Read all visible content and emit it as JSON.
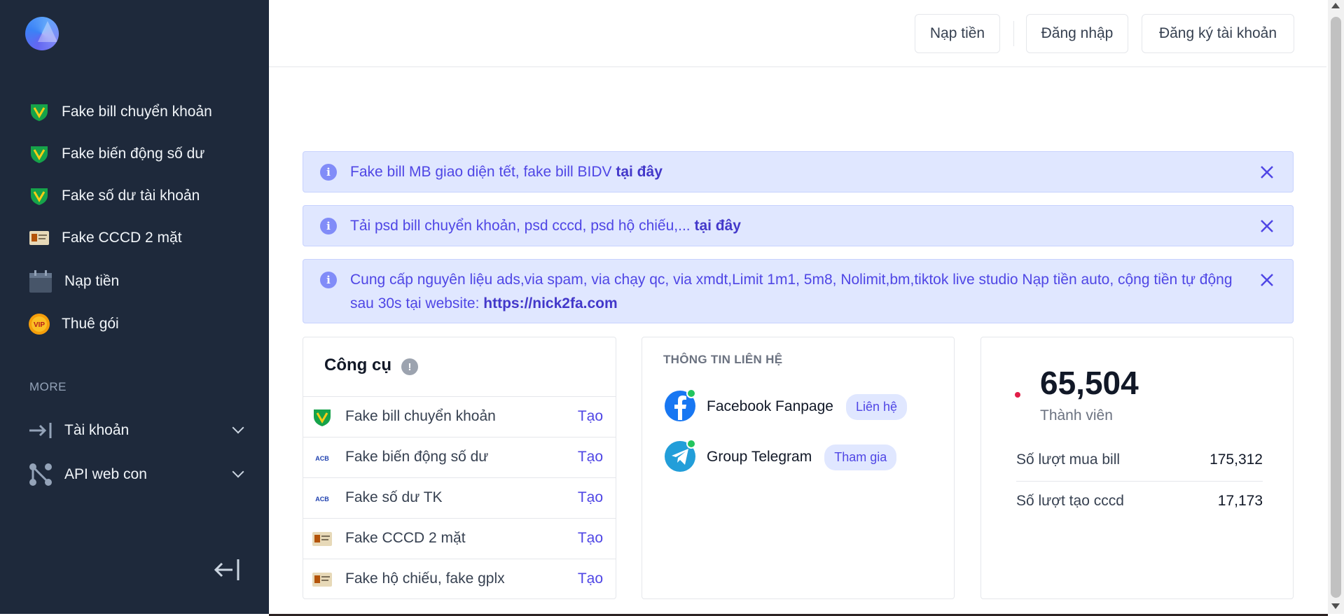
{
  "sidebar": {
    "items": [
      {
        "label": "Fake bill chuyển khoản",
        "icon": "bank-shield-icon"
      },
      {
        "label": "Fake biến động số dư",
        "icon": "bank-shield-icon"
      },
      {
        "label": "Fake số dư tài khoản",
        "icon": "bank-shield-icon"
      },
      {
        "label": "Fake CCCD 2 mặt",
        "icon": "id-card-icon"
      },
      {
        "label": "Nạp tiền",
        "icon": "calendar-icon"
      },
      {
        "label": "Thuê gói",
        "icon": "vip-badge-icon"
      }
    ],
    "section_label": "MORE",
    "more_items": [
      {
        "label": "Tài khoản",
        "icon": "login-arrow-icon"
      },
      {
        "label": "API web con",
        "icon": "nodes-icon"
      }
    ]
  },
  "header": {
    "deposit_label": "Nạp tiền",
    "login_label": "Đăng nhập",
    "register_label": "Đăng ký tài khoản"
  },
  "alerts": [
    {
      "text": "Fake bill MB giao diện tết, fake bill BIDV ",
      "link": "tại đây"
    },
    {
      "text": "Tải psd bill chuyển khoản, psd cccd, psd hộ chiếu,... ",
      "link": "tại đây"
    },
    {
      "text": "Cung cấp nguyên liệu ads,via spam, via chạy qc, via xmdt,Limit 1m1, 5m8, Nolimit,bm,tiktok live studio Nạp tiền auto, cộng tiền tự động sau 30s tại website: ",
      "link": "https://nick2fa.com"
    }
  ],
  "tools": {
    "title": "Công cụ",
    "info_icon": "!",
    "rows": [
      {
        "name": "Fake bill chuyển khoản",
        "action": "Tạo",
        "icon": "bank-shield-icon"
      },
      {
        "name": "Fake biến động số dư",
        "action": "Tạo",
        "icon": "acb-logo-icon"
      },
      {
        "name": "Fake số dư TK",
        "action": "Tạo",
        "icon": "acb-logo-icon"
      },
      {
        "name": "Fake CCCD 2 mặt",
        "action": "Tạo",
        "icon": "id-card-icon"
      },
      {
        "name": "Fake hộ chiếu, fake gplx",
        "action": "Tạo",
        "icon": "id-card-icon"
      }
    ]
  },
  "contact": {
    "title": "THÔNG TIN LIÊN HỆ",
    "rows": [
      {
        "name": "Facebook Fanpage",
        "action": "Liên hệ",
        "icon": "facebook-icon"
      },
      {
        "name": "Group Telegram",
        "action": "Tham gia",
        "icon": "telegram-icon"
      }
    ]
  },
  "stats": {
    "members": "65,504",
    "members_label": "Thành viên",
    "rows": [
      {
        "label": "Số lượt mua bill",
        "value": "175,312"
      },
      {
        "label": "Số lượt tạo cccd",
        "value": "17,173"
      }
    ]
  },
  "vip_text": "VIP",
  "acb_text": "ACB",
  "colors": {
    "sidebar_bg": "#1e293b",
    "accent": "#4f46e5",
    "alert_bg": "#e0e7ff"
  }
}
